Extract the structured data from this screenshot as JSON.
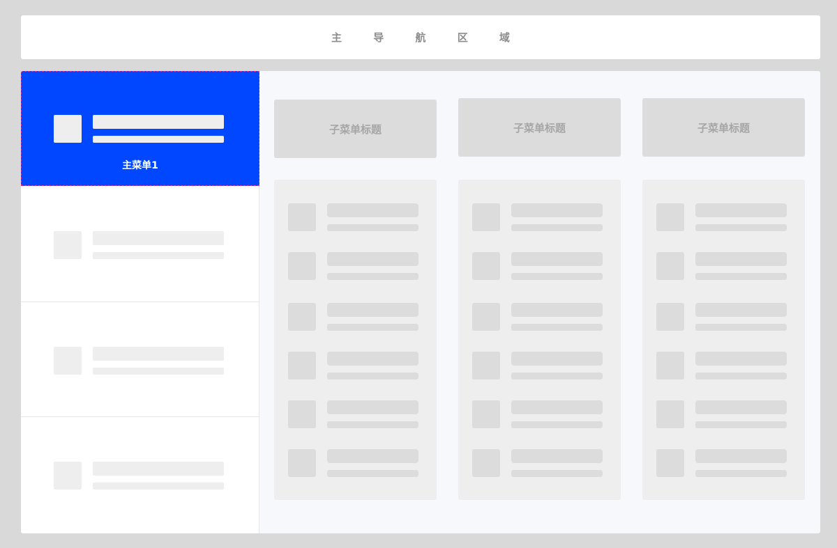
{
  "top_nav": {
    "title": "主 导 航 区 域"
  },
  "sidebar": {
    "items": [
      {
        "label": "主菜单1",
        "active": true
      },
      {
        "label": "",
        "active": false
      },
      {
        "label": "",
        "active": false
      },
      {
        "label": "",
        "active": false
      }
    ]
  },
  "content": {
    "columns": [
      {
        "title": "子菜单标题"
      },
      {
        "title": "子菜单标题"
      },
      {
        "title": "子菜单标题"
      }
    ]
  },
  "colors": {
    "background": "#d9d9d9",
    "active_menu": "#0047ff",
    "placeholder": "#eeeeee",
    "placeholder_dark": "#dcdcdc"
  }
}
